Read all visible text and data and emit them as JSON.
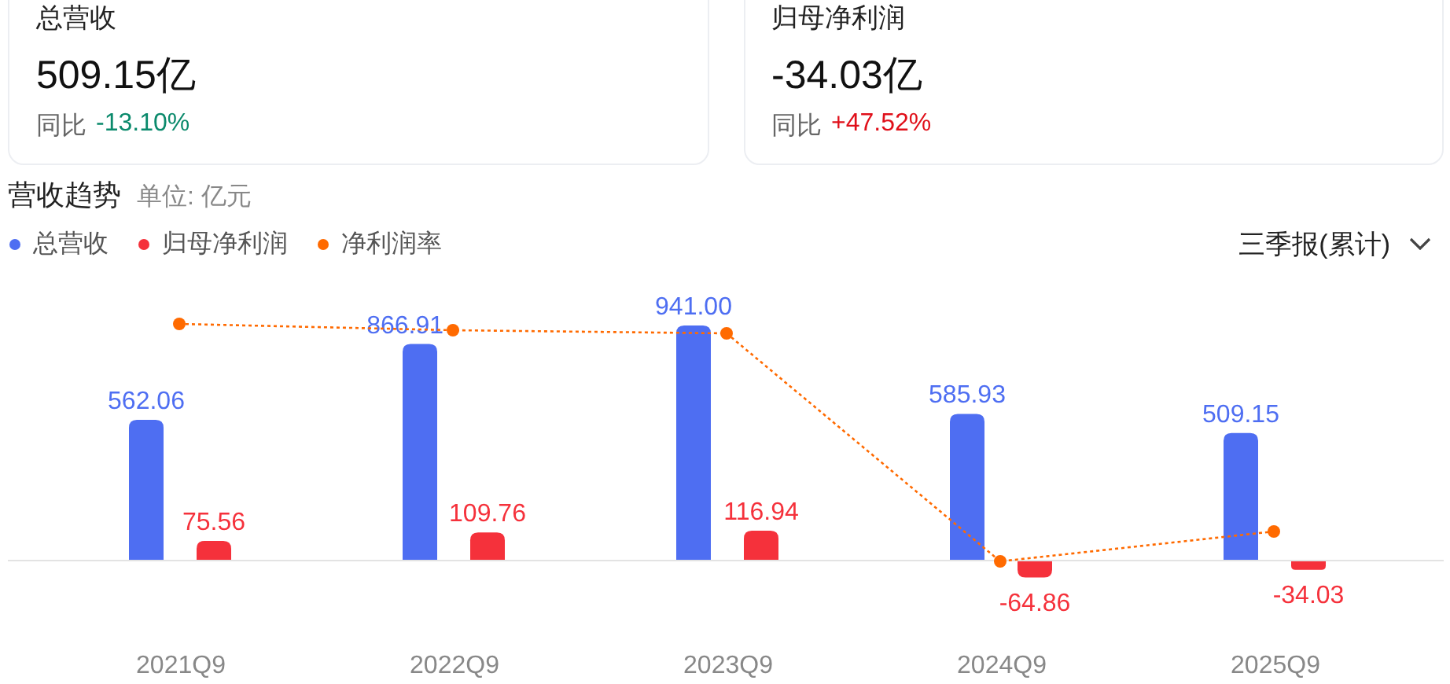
{
  "cards": [
    {
      "title": "总营收",
      "value": "509.15亿",
      "change_label": "同比",
      "change": "-13.10%",
      "color": "#0b8a6c"
    },
    {
      "title": "归母净利润",
      "value": "-34.03亿",
      "change_label": "同比",
      "change": "+47.52%",
      "color": "#e0101a"
    }
  ],
  "section": {
    "title": "营收趋势",
    "unit": "单位: 亿元"
  },
  "period_select": {
    "value": "三季报(累计)"
  },
  "chart_data": {
    "type": "bar",
    "stacked": false,
    "data_labels": true,
    "categories": [
      "2021Q9",
      "2022Q9",
      "2023Q9",
      "2024Q9",
      "2025Q9"
    ],
    "series": [
      {
        "name": "总营收",
        "color": "#4e6ef2",
        "values": [
          562.06,
          866.91,
          941.0,
          585.93,
          509.15
        ],
        "value_labels": [
          "562.06",
          "866.91",
          "941.00",
          "585.93",
          "509.15"
        ]
      },
      {
        "name": "归母净利润",
        "color": "#f5313b",
        "values": [
          75.56,
          109.76,
          116.94,
          -64.86,
          -34.03
        ],
        "value_labels": [
          "75.56",
          "109.76",
          "116.94",
          "-64.86",
          "-34.03"
        ]
      }
    ]
  },
  "margin_line": {
    "name": "净利润率",
    "color": "#ff6a00"
  }
}
